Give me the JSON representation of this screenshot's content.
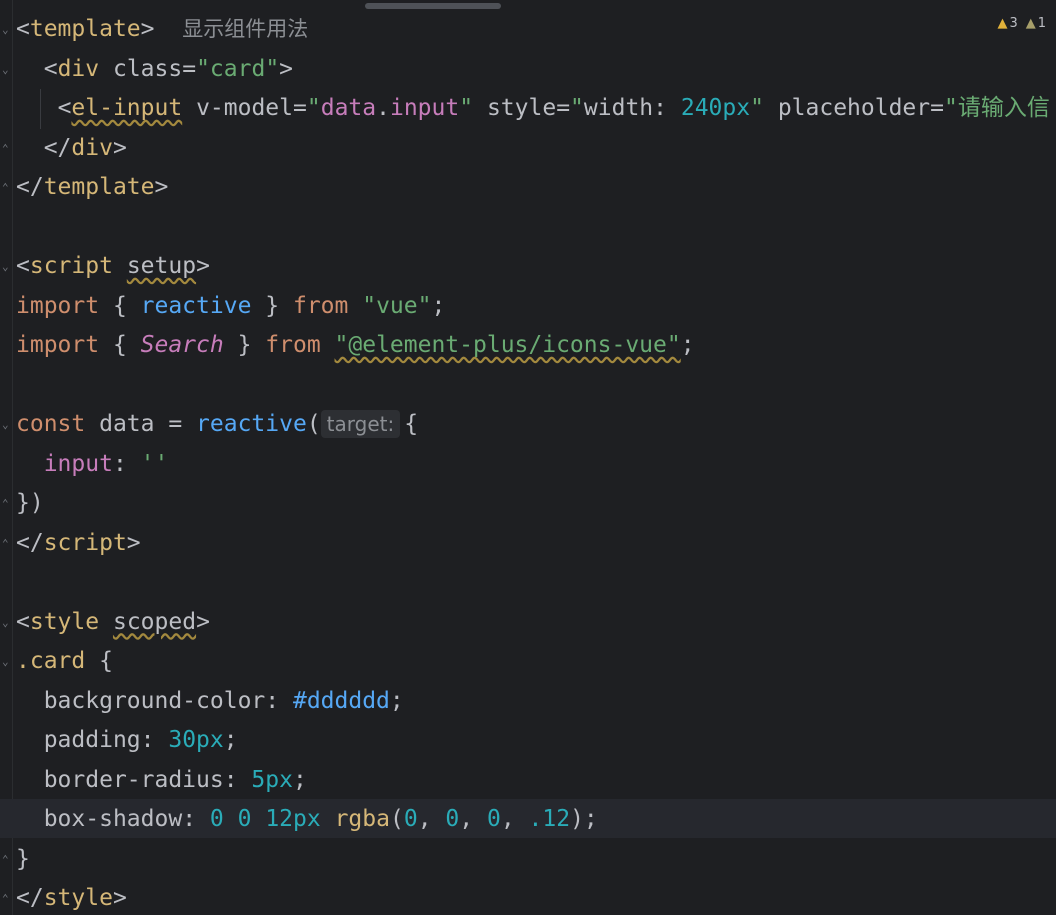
{
  "inspections": {
    "warning_icon": "warning-icon",
    "warnings": "3",
    "weak_icon": "weak-warning-icon",
    "weak_warnings": "1"
  },
  "lines": {
    "l1": {
      "tag_open": "<",
      "tag": "template",
      "tag_close": ">",
      "hint": "显示组件用法"
    },
    "l2": {
      "indent": "  ",
      "lt": "<",
      "tag": "div",
      "sp": " ",
      "attr": "class",
      "eq": "=",
      "val": "\"card\"",
      "gt": ">"
    },
    "l3": {
      "indent": "  ",
      "lt": "<",
      "tag": "el-input",
      "sp1": " ",
      "attr1": "v-model",
      "eq1": "=",
      "q1": "\"",
      "v1a": "data",
      "dot": ".",
      "v1b": "input",
      "q2": "\"",
      "sp2": " ",
      "attr2": "style",
      "eq2": "=",
      "q3": "\"",
      "v2a": "width: ",
      "v2b": "240px",
      "q4": "\"",
      "sp3": " ",
      "attr3": "placeholder",
      "eq3": "=",
      "q5": "\"",
      "v3": "请输入",
      "v3cut": "信"
    },
    "l4": {
      "indent": "  ",
      "lt": "</",
      "tag": "div",
      "gt": ">"
    },
    "l5": {
      "lt": "</",
      "tag": "template",
      "gt": ">"
    },
    "l6": {
      "text": ""
    },
    "l7": {
      "lt": "<",
      "tag": "script",
      "sp": " ",
      "attr": "setup",
      "gt": ">"
    },
    "l8": {
      "kw": "import",
      "b1": " { ",
      "name": "reactive",
      "b2": " } ",
      "from": "from",
      "sp": " ",
      "str": "\"vue\"",
      "semi": ";"
    },
    "l9": {
      "kw": "import",
      "b1": " { ",
      "name": "Search",
      "b2": " } ",
      "from": "from",
      "sp": " ",
      "str": "\"@element-plus/icons-vue\"",
      "semi": ";"
    },
    "l10": {
      "text": ""
    },
    "l11": {
      "kw": "const",
      "mid": " data = ",
      "fn": "reactive",
      "paren": "(",
      "chip": "target:",
      "brace": "{"
    },
    "l12": {
      "indent": "  ",
      "prop": "input",
      "colon": ": ",
      "str": "''"
    },
    "l13": {
      "text": "})"
    },
    "l14": {
      "lt": "</",
      "tag": "script",
      "gt": ">"
    },
    "l15": {
      "text": ""
    },
    "l16": {
      "lt": "<",
      "tag": "style",
      "sp": " ",
      "attr": "scoped",
      "gt": ">"
    },
    "l17": {
      "sel": ".card",
      "brace": " {"
    },
    "l18": {
      "indent": "  ",
      "prop": "background-color",
      "colon": ": ",
      "val": "#dddddd",
      "semi": ";"
    },
    "l19": {
      "indent": "  ",
      "prop": "padding",
      "colon": ": ",
      "val": "30px",
      "semi": ";"
    },
    "l20": {
      "indent": "  ",
      "prop": "border-radius",
      "colon": ": ",
      "val": "5px",
      "semi": ";"
    },
    "l21": {
      "indent": "  ",
      "prop": "box-shadow",
      "colon": ": ",
      "n1": "0",
      "sp1": " ",
      "n2": "0",
      "sp2": " ",
      "n3": "12px",
      "sp3": " ",
      "fn": "rgba",
      "lp": "(",
      "n4": "0",
      "c1": ", ",
      "n5": "0",
      "c2": ", ",
      "n6": "0",
      "c3": ", ",
      "n7": ".12",
      "rp": ")",
      "semi": ";"
    },
    "l22": {
      "text": "}"
    },
    "l23": {
      "lt": "</",
      "tag": "style",
      "gt": ">"
    }
  }
}
